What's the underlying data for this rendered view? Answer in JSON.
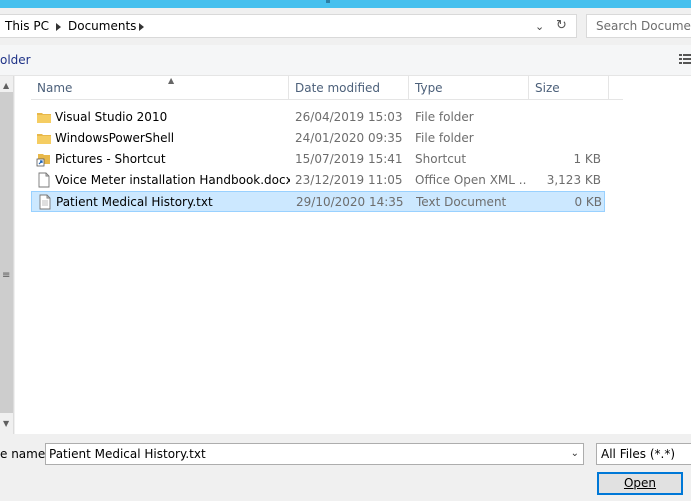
{
  "address": {
    "crumbs": [
      "This PC",
      "Documents"
    ]
  },
  "search": {
    "placeholder": "Search Documents"
  },
  "toolbar": {
    "new_folder_label": "older"
  },
  "columns": {
    "name": "Name",
    "date": "Date modified",
    "type": "Type",
    "size": "Size"
  },
  "files": [
    {
      "name": "Visual Studio 2010",
      "date": "26/04/2019 15:03",
      "type": "File folder",
      "size": "",
      "icon": "folder-icon"
    },
    {
      "name": "WindowsPowerShell",
      "date": "24/01/2020 09:35",
      "type": "File folder",
      "size": "",
      "icon": "folder-icon"
    },
    {
      "name": "Pictures - Shortcut",
      "date": "15/07/2019 15:41",
      "type": "Shortcut",
      "size": "1 KB",
      "icon": "shortcut-icon"
    },
    {
      "name": "Voice Meter installation Handbook.docx",
      "date": "23/12/2019 11:05",
      "type": "Office Open XML ...",
      "size": "3,123 KB",
      "icon": "document-icon"
    },
    {
      "name": "Patient Medical History.txt",
      "date": "29/10/2020 14:35",
      "type": "Text Document",
      "size": "0 KB",
      "icon": "text-file-icon",
      "selected": true
    }
  ],
  "filename": {
    "label": "e name:",
    "value": "Patient Medical History.txt"
  },
  "filter": {
    "value": "All Files (*.*)"
  },
  "buttons": {
    "open_label": "Open"
  },
  "colors": {
    "selection_bg": "#cce8ff",
    "selection_border": "#99d1ff",
    "accent": "#0078d7",
    "folder": "#e8b84a"
  }
}
